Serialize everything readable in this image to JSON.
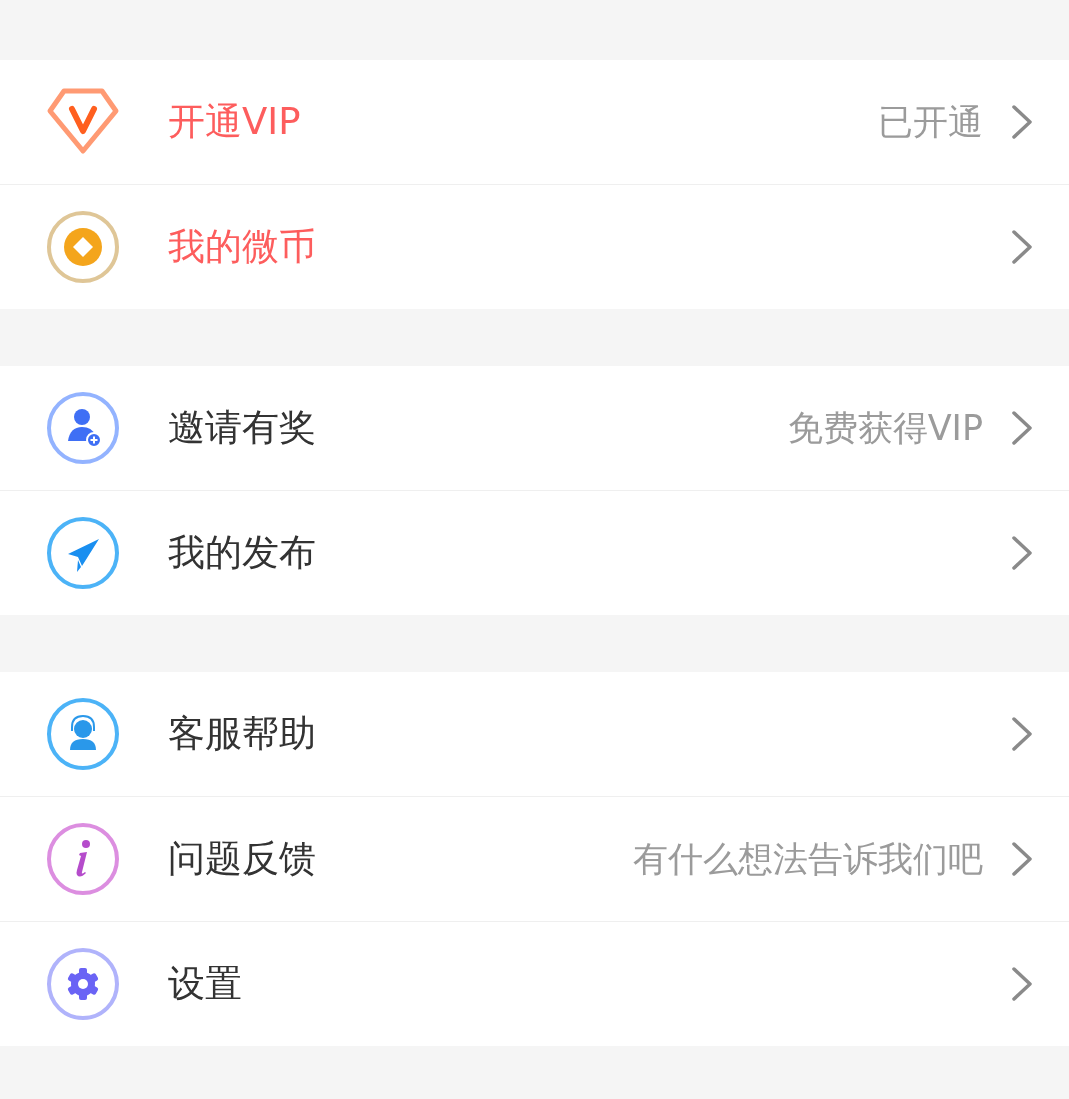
{
  "groups": [
    {
      "items": [
        {
          "title": "开通VIP",
          "highlighted": true,
          "hint": "已开通"
        },
        {
          "title": "我的微币",
          "highlighted": true
        }
      ]
    },
    {
      "items": [
        {
          "title": "邀请有奖",
          "highlighted": false,
          "hint": "免费获得VIP"
        },
        {
          "title": "我的发布",
          "highlighted": false
        }
      ]
    },
    {
      "items": [
        {
          "title": "客服帮助",
          "highlighted": false
        },
        {
          "title": "问题反馈",
          "highlighted": false,
          "hint": "有什么想法告诉我们吧"
        },
        {
          "title": "设置",
          "highlighted": false
        }
      ]
    }
  ]
}
